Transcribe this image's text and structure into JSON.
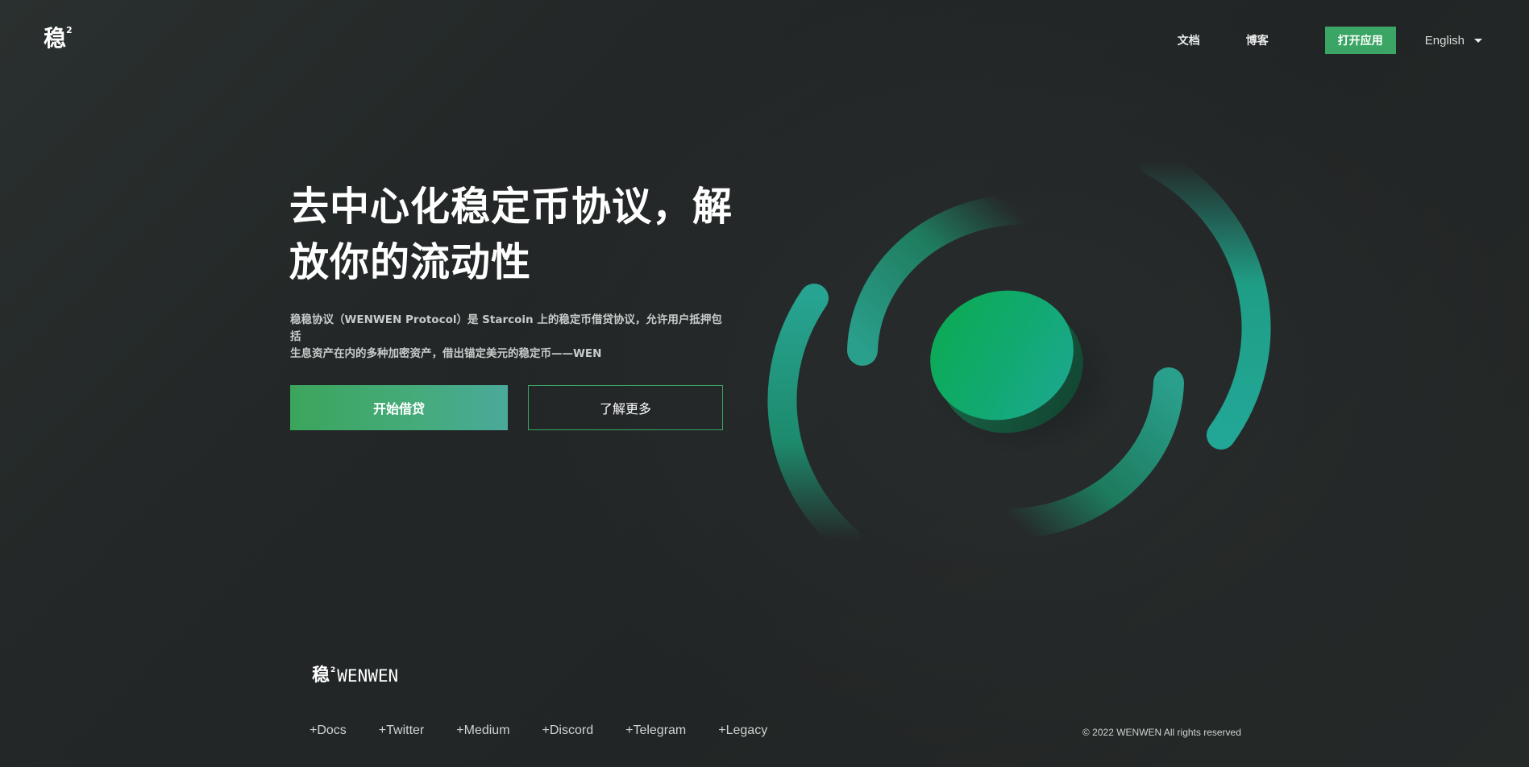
{
  "header": {
    "logo": {
      "mark": "稳",
      "sup": "2"
    },
    "nav": {
      "docs_label": "文档",
      "blog_label": "博客",
      "open_app_label": "打开应用",
      "language_label": "English"
    }
  },
  "hero": {
    "title_line1": "去中心化稳定币协议，解",
    "title_line2": "放你的流动性",
    "description_line1": "稳稳协议（WENWEN Protocol）是 Starcoin 上的稳定币借贷协议，允许用户抵押包括",
    "description_line2": "生息资产在内的多种加密资产，借出锚定美元的稳定币——WEN",
    "primary_button_label": "开始借贷",
    "secondary_button_label": "了解更多"
  },
  "footer": {
    "logo": {
      "mark": "稳",
      "sup": "2",
      "word": "WENWEN"
    },
    "links": [
      "+Docs",
      "+Twitter",
      "+Medium",
      "+Discord",
      "+Telegram",
      "+Legacy"
    ],
    "copyright": "© 2022 WENWEN All rights reserved"
  },
  "colors": {
    "accent": "#3aa564",
    "background": "#232727",
    "graphic_teal": "#1fa597",
    "graphic_green": "#0aaa55"
  },
  "icons": {
    "language_caret": "caret-down-icon",
    "hero_graphic": "coin-orbit-graphic"
  }
}
